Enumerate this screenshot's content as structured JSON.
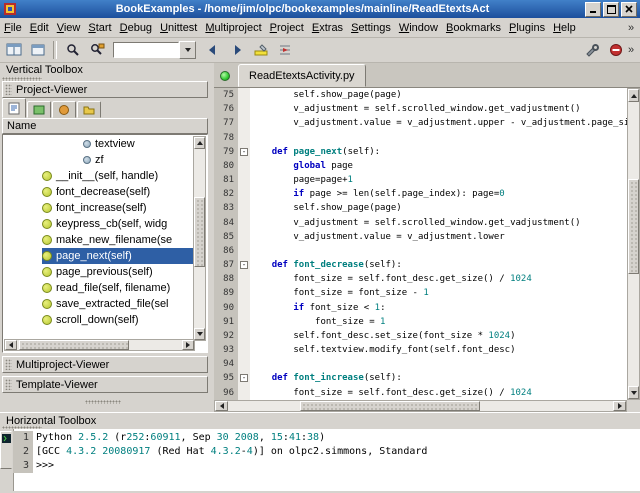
{
  "window": {
    "title": "BookExamples - /home/jim/olpc/bookexamples/mainline/ReadEtextsAct"
  },
  "menubar": {
    "items": [
      "File",
      "Edit",
      "View",
      "Start",
      "Debug",
      "Unittest",
      "Multiproject",
      "Project",
      "Extras",
      "Settings",
      "Window",
      "Bookmarks",
      "Plugins",
      "Help"
    ]
  },
  "toolbar": {
    "quicksearch_value": ""
  },
  "vertical_toolbox": {
    "title": "Vertical Toolbox",
    "project_viewer": {
      "header": "Project-Viewer",
      "column_header": "Name",
      "items": [
        {
          "icon": "attribute-icon",
          "label": "textview",
          "indent": 2,
          "selected": false
        },
        {
          "icon": "attribute-icon",
          "label": "zf",
          "indent": 2,
          "selected": false
        },
        {
          "icon": "method-icon",
          "label": "__init__(self, handle)",
          "indent": 1,
          "selected": false
        },
        {
          "icon": "method-icon",
          "label": "font_decrease(self)",
          "indent": 1,
          "selected": false
        },
        {
          "icon": "method-icon",
          "label": "font_increase(self)",
          "indent": 1,
          "selected": false
        },
        {
          "icon": "method-icon",
          "label": "keypress_cb(self, widg",
          "indent": 1,
          "selected": false
        },
        {
          "icon": "method-icon",
          "label": "make_new_filename(se",
          "indent": 1,
          "selected": false
        },
        {
          "icon": "method-icon",
          "label": "page_next(self)",
          "indent": 1,
          "selected": true
        },
        {
          "icon": "method-icon",
          "label": "page_previous(self)",
          "indent": 1,
          "selected": false
        },
        {
          "icon": "method-icon",
          "label": "read_file(self, filename)",
          "indent": 1,
          "selected": false
        },
        {
          "icon": "method-icon",
          "label": "save_extracted_file(sel",
          "indent": 1,
          "selected": false
        },
        {
          "icon": "method-icon",
          "label": "scroll_down(self)",
          "indent": 1,
          "selected": false
        }
      ]
    },
    "multiproject_header": "Multiproject-Viewer",
    "template_header": "Template-Viewer"
  },
  "editor": {
    "tab_label": "ReadEtextsActivity.py",
    "lines": [
      {
        "n": 75,
        "fold": "",
        "tokens": [
          [
            "p",
            "        self.show_page(page)"
          ]
        ]
      },
      {
        "n": 76,
        "fold": "",
        "tokens": [
          [
            "p",
            "        v_adjustment = self.scrolled_window.get_vadjustment()"
          ]
        ]
      },
      {
        "n": 77,
        "fold": "",
        "tokens": [
          [
            "p",
            "        v_adjustment.value = v_adjustment.upper - v_adjustment.page_si"
          ]
        ]
      },
      {
        "n": 78,
        "fold": "",
        "tokens": []
      },
      {
        "n": 79,
        "fold": "-",
        "tokens": [
          [
            "p",
            "    "
          ],
          [
            "k",
            "def"
          ],
          [
            "p",
            " "
          ],
          [
            "d",
            "page_next"
          ],
          [
            "p",
            "(self):"
          ]
        ]
      },
      {
        "n": 80,
        "fold": "",
        "tokens": [
          [
            "p",
            "        "
          ],
          [
            "k",
            "global"
          ],
          [
            "p",
            " page"
          ]
        ]
      },
      {
        "n": 81,
        "fold": "",
        "tokens": [
          [
            "p",
            "        page=page+"
          ],
          [
            "n",
            "1"
          ]
        ]
      },
      {
        "n": 82,
        "fold": "",
        "tokens": [
          [
            "p",
            "        "
          ],
          [
            "k",
            "if"
          ],
          [
            "p",
            " page >= len(self.page_index): page="
          ],
          [
            "n",
            "0"
          ]
        ]
      },
      {
        "n": 83,
        "fold": "",
        "tokens": [
          [
            "p",
            "        self.show_page(page)"
          ]
        ]
      },
      {
        "n": 84,
        "fold": "",
        "tokens": [
          [
            "p",
            "        v_adjustment = self.scrolled_window.get_vadjustment()"
          ]
        ]
      },
      {
        "n": 85,
        "fold": "",
        "tokens": [
          [
            "p",
            "        v_adjustment.value = v_adjustment.lower"
          ]
        ]
      },
      {
        "n": 86,
        "fold": "",
        "tokens": []
      },
      {
        "n": 87,
        "fold": "-",
        "tokens": [
          [
            "p",
            "    "
          ],
          [
            "k",
            "def"
          ],
          [
            "p",
            " "
          ],
          [
            "d",
            "font_decrease"
          ],
          [
            "p",
            "(self):"
          ]
        ]
      },
      {
        "n": 88,
        "fold": "",
        "tokens": [
          [
            "p",
            "        font_size = self.font_desc.get_size() / "
          ],
          [
            "n",
            "1024"
          ]
        ]
      },
      {
        "n": 89,
        "fold": "",
        "tokens": [
          [
            "p",
            "        font_size = font_size - "
          ],
          [
            "n",
            "1"
          ]
        ]
      },
      {
        "n": 90,
        "fold": "",
        "tokens": [
          [
            "p",
            "        "
          ],
          [
            "k",
            "if"
          ],
          [
            "p",
            " font_size < "
          ],
          [
            "n",
            "1"
          ],
          [
            "p",
            ":"
          ]
        ]
      },
      {
        "n": 91,
        "fold": "",
        "tokens": [
          [
            "p",
            "            font_size = "
          ],
          [
            "n",
            "1"
          ]
        ]
      },
      {
        "n": 92,
        "fold": "",
        "tokens": [
          [
            "p",
            "        self.font_desc.set_size(font_size * "
          ],
          [
            "n",
            "1024"
          ],
          [
            "p",
            ")"
          ]
        ]
      },
      {
        "n": 93,
        "fold": "",
        "tokens": [
          [
            "p",
            "        self.textview.modify_font(self.font_desc)"
          ]
        ]
      },
      {
        "n": 94,
        "fold": "",
        "tokens": []
      },
      {
        "n": 95,
        "fold": "-",
        "tokens": [
          [
            "p",
            "    "
          ],
          [
            "k",
            "def"
          ],
          [
            "p",
            " "
          ],
          [
            "d",
            "font_increase"
          ],
          [
            "p",
            "(self):"
          ]
        ]
      },
      {
        "n": 96,
        "fold": "",
        "tokens": [
          [
            "p",
            "        font_size = self.font_desc.get_size() / "
          ],
          [
            "n",
            "1024"
          ]
        ]
      }
    ]
  },
  "horizontal_toolbox": {
    "title": "Horizontal Toolbox",
    "shell": {
      "lines": [
        {
          "n": 1,
          "tokens": [
            [
              "p",
              "Python "
            ],
            [
              "n",
              "2.5.2"
            ],
            [
              "p",
              " (r"
            ],
            [
              "n",
              "252"
            ],
            [
              "p",
              ":"
            ],
            [
              "n",
              "60911"
            ],
            [
              "p",
              ", Sep "
            ],
            [
              "n",
              "30"
            ],
            [
              "p",
              " "
            ],
            [
              "n",
              "2008"
            ],
            [
              "p",
              ", "
            ],
            [
              "n",
              "15"
            ],
            [
              "p",
              ":"
            ],
            [
              "n",
              "41"
            ],
            [
              "p",
              ":"
            ],
            [
              "n",
              "38"
            ],
            [
              "p",
              ")"
            ]
          ]
        },
        {
          "n": 2,
          "tokens": [
            [
              "p",
              "[GCC "
            ],
            [
              "n",
              "4.3.2"
            ],
            [
              "p",
              " "
            ],
            [
              "n",
              "20080917"
            ],
            [
              "p",
              " (Red Hat "
            ],
            [
              "n",
              "4.3.2"
            ],
            [
              "p",
              "-"
            ],
            [
              "n",
              "4"
            ],
            [
              "p",
              ")] on olpc2.simmons, Standard"
            ]
          ]
        },
        {
          "n": 3,
          "tokens": [
            [
              "p",
              ">>> "
            ]
          ]
        }
      ]
    }
  },
  "colors": {
    "titlebar_start": "#4180c8",
    "titlebar_end": "#1c4f9c",
    "selection": "#2e5fa5",
    "keyword": "#0000c0",
    "number": "#007f7f",
    "defname": "#007f7f",
    "led": "#33cc33"
  }
}
